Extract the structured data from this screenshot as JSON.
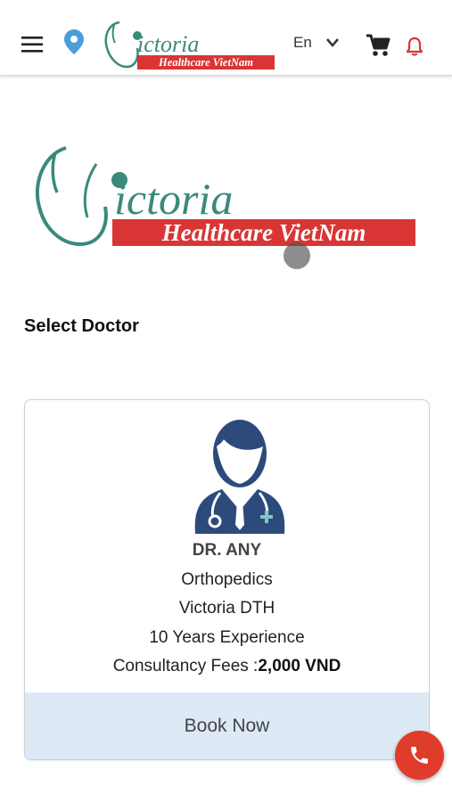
{
  "header": {
    "language": "En",
    "menu_icon": "hamburger-menu-icon",
    "location_icon": "map-pin-icon",
    "cart_icon": "shopping-cart-icon",
    "bell_icon": "notification-bell-icon",
    "logo_word": "ictoria",
    "logo_tagline": "Healthcare VietNam"
  },
  "main": {
    "logo_word": "ictoria",
    "logo_tagline": "Healthcare VietNam",
    "section_title": "Select Doctor"
  },
  "doctor": {
    "name": "DR. ANY",
    "specialty": "Orthopedics",
    "hospital": "Victoria DTH",
    "experience": "10 Years Experience",
    "fees_label": "Consultancy Fees :",
    "fees_value": "2,000 VND",
    "book_label": "Book Now"
  },
  "colors": {
    "brand_teal": "#3a8a7c",
    "brand_red": "#d93535",
    "book_bg": "#ddeaf6",
    "fab_red": "#e03c2c",
    "avatar_navy": "#2c4a7c"
  },
  "fab": {
    "icon": "phone-icon"
  }
}
